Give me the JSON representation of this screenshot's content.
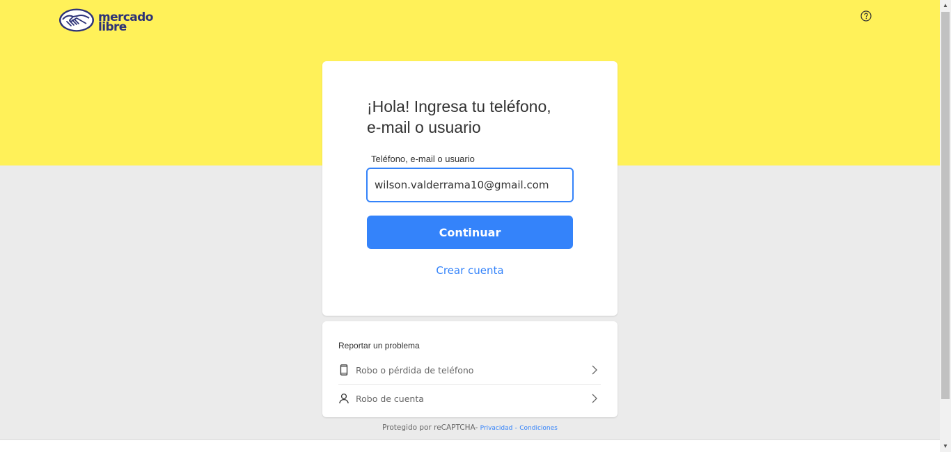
{
  "header": {
    "logo_text_line1": "mercado",
    "logo_text_line2": "libre",
    "help_icon": "help-circle-icon"
  },
  "login": {
    "title_line1": "¡Hola! Ingresa tu teléfono,",
    "title_line2": "e-mail o usuario",
    "field_label": "Teléfono, e-mail o usuario",
    "field_value": "wilson.valderrama10@gmail.com",
    "continue_label": "Continuar",
    "create_account_label": "Crear cuenta"
  },
  "report": {
    "title": "Reportar un problema",
    "items": [
      {
        "label": "Robo o pérdida de teléfono",
        "icon": "phone-icon"
      },
      {
        "label": "Robo de cuenta",
        "icon": "user-icon"
      }
    ]
  },
  "footer": {
    "recaptcha_text": "Protegido por reCAPTCHA-",
    "privacy_label": "Privacidad",
    "separator": "-",
    "terms_label": "Condiciones"
  },
  "colors": {
    "brand_yellow": "#fff159",
    "accent_blue": "#3483fa",
    "logo_navy": "#2d3277",
    "background_gray": "#ebebeb"
  }
}
